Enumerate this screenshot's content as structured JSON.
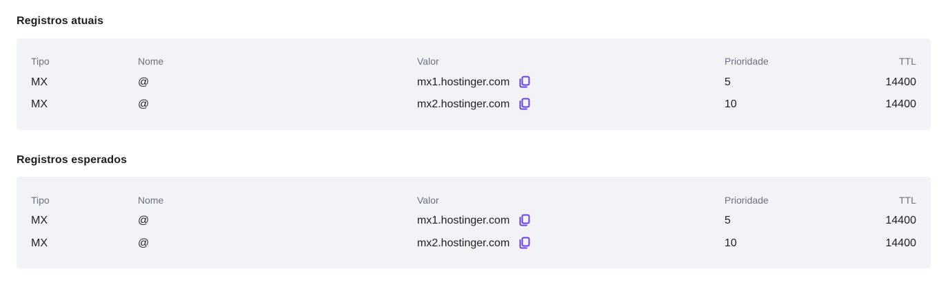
{
  "current": {
    "title": "Registros atuais",
    "headers": {
      "tipo": "Tipo",
      "nome": "Nome",
      "valor": "Valor",
      "prioridade": "Prioridade",
      "ttl": "TTL"
    },
    "rows": [
      {
        "tipo": "MX",
        "nome": "@",
        "valor": "mx1.hostinger.com",
        "prioridade": "5",
        "ttl": "14400"
      },
      {
        "tipo": "MX",
        "nome": "@",
        "valor": "mx2.hostinger.com",
        "prioridade": "10",
        "ttl": "14400"
      }
    ]
  },
  "expected": {
    "title": "Registros esperados",
    "headers": {
      "tipo": "Tipo",
      "nome": "Nome",
      "valor": "Valor",
      "prioridade": "Prioridade",
      "ttl": "TTL"
    },
    "rows": [
      {
        "tipo": "MX",
        "nome": "@",
        "valor": "mx1.hostinger.com",
        "prioridade": "5",
        "ttl": "14400"
      },
      {
        "tipo": "MX",
        "nome": "@",
        "valor": "mx2.hostinger.com",
        "prioridade": "10",
        "ttl": "14400"
      }
    ]
  },
  "icons": {
    "copy": "copy-icon"
  },
  "colors": {
    "accent": "#673de6",
    "card_bg": "#f2f3f6",
    "header_text": "#6d7081",
    "text": "#1d1e20"
  }
}
